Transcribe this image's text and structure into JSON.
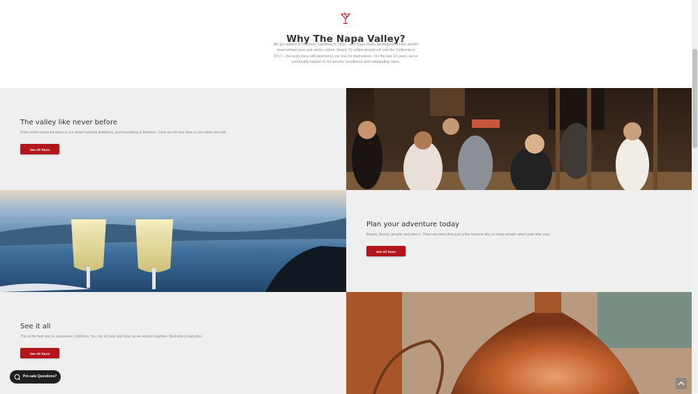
{
  "intro": {
    "icon": "cocktail-glass-icon",
    "title": "Why The Napa Valley?",
    "body_lines": [
      "We got started in Southern California in 1992 – and Napa Valley developed into the world's",
      "most refined wine and spirits culture. Nearly 50 million people will visit the California in",
      "2017 – the lucky ones will experience our tour for themselves. For the last 10 years, we've",
      "continually ranked #1 for service, excellence and outstanding value."
    ]
  },
  "sections": [
    {
      "title": "The valley like never before",
      "body": "From world renowned wines to our award winning distilleries, and everything in between - here are the key sites to see when you visit.",
      "button": "See All Tours",
      "image": "restaurant-patrons-photo"
    },
    {
      "title": "Plan your adventure today",
      "body": "Beauty, flavour, people, and places. There are more than just a few reasons why so many people return year after year.",
      "button": "See All Tours",
      "image": "champagne-glasses-photo"
    },
    {
      "title": "See it all",
      "body": "This is the best way to experience California. You can sit back and relax as we explore together. Welcome to paradise.",
      "button": "See All Tours",
      "image": "copper-still-photo"
    }
  ],
  "chat": {
    "label": "Pre-sale Questions?",
    "icon": "chat-bubble-icon"
  },
  "scroll_top": {
    "icon": "chevron-up-icon"
  },
  "colors": {
    "accent": "#b2151b",
    "panel_bg": "#efefef",
    "chat_bg": "#1f1f1f"
  }
}
